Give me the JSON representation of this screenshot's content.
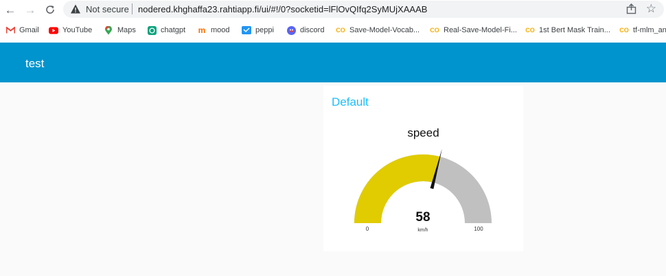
{
  "browser": {
    "security_label": "Not secure",
    "url": "nodered.khghaffa23.rahtiapp.fi/ui/#!/0?socketid=lFlOvQIfq2SyMUjXAAAB",
    "bookmarks": [
      {
        "label": "Gmail",
        "icon": "gmail-icon",
        "color": "#ea4335"
      },
      {
        "label": "YouTube",
        "icon": "youtube-icon",
        "color": "#ff0000"
      },
      {
        "label": "Maps",
        "icon": "maps-icon",
        "color": "#34a853"
      },
      {
        "label": "chatgpt",
        "icon": "chatgpt-icon",
        "color": "#10a37f"
      },
      {
        "label": "mood",
        "icon": "mood-icon",
        "color": "#ff6d00"
      },
      {
        "label": "peppi",
        "icon": "peppi-icon",
        "color": "#2196f3"
      },
      {
        "label": "discord",
        "icon": "discord-icon",
        "color": "#5865f2"
      },
      {
        "label": "Save-Model-Vocab...",
        "icon": "colab-icon",
        "color": "#f9ab00"
      },
      {
        "label": "Real-Save-Model-Fi...",
        "icon": "colab-icon",
        "color": "#f9ab00"
      },
      {
        "label": "1st Bert Mask Train...",
        "icon": "colab-icon",
        "color": "#f9ab00"
      },
      {
        "label": "tf-mlm_an",
        "icon": "colab-icon",
        "color": "#f9ab00"
      }
    ]
  },
  "dashboard": {
    "title": "test",
    "header_color": "#0094ce",
    "group": {
      "title": "Default",
      "gauge": {
        "label": "speed",
        "value": 58,
        "value_text": "58",
        "units": "km/h",
        "min": 0,
        "max": 100,
        "min_label": "0",
        "max_label": "100",
        "fill_color": "#e0cc00",
        "track_color": "#c0c0c0",
        "needle_color": "#111111"
      }
    }
  }
}
